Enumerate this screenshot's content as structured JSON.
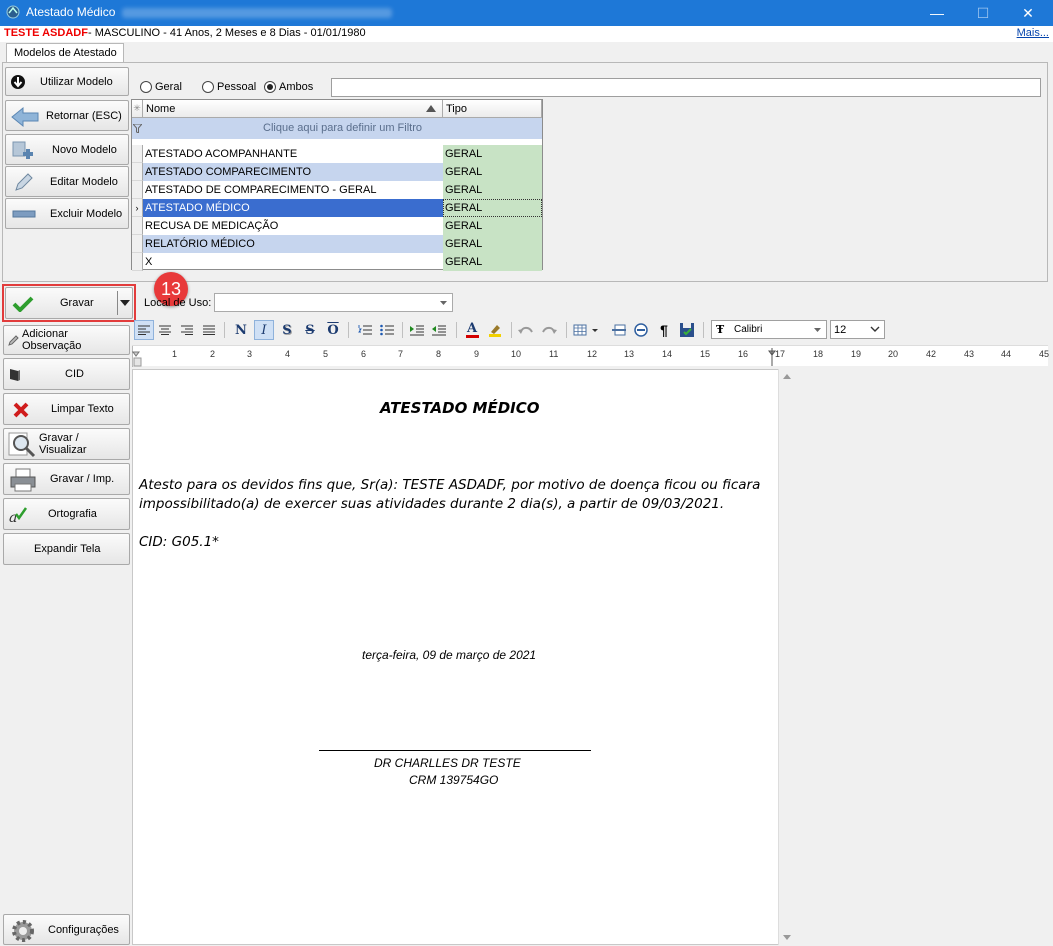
{
  "window": {
    "title": "Atestado Médico",
    "controls": {
      "minimize": "—",
      "maximize": "☐",
      "close": "✕"
    }
  },
  "patient": {
    "name": "TESTE ASDADF",
    "info": " - MASCULINO - 41 Anos, 2 Meses e 8 Dias - 01/01/1980",
    "more_link": "Mais..."
  },
  "tabs": [
    {
      "label": "Modelos de Atestado",
      "active": true
    }
  ],
  "model_actions": [
    {
      "label": "Utilizar Modelo",
      "icon": "arrow-down-circle-icon"
    },
    {
      "label": "Retornar (ESC)",
      "icon": "arrow-left-icon"
    },
    {
      "label": "Novo Modelo",
      "icon": "plus-icon"
    },
    {
      "label": "Editar Modelo",
      "icon": "pencil-icon"
    },
    {
      "label": "Excluir Modelo",
      "icon": "minus-icon"
    }
  ],
  "filters": {
    "options": [
      {
        "label": "Geral",
        "selected": false
      },
      {
        "label": "Pessoal",
        "selected": false
      },
      {
        "label": "Ambos",
        "selected": true
      }
    ],
    "search_value": ""
  },
  "grid": {
    "columns": [
      "Nome",
      "Tipo"
    ],
    "filter_row_text": "Clique aqui para definir um Filtro",
    "rows": [
      {
        "name": "ATESTADO ACOMPANHANTE",
        "type": "GERAL",
        "state": "normal"
      },
      {
        "name": "ATESTADO COMPARECIMENTO",
        "type": "GERAL",
        "state": "alt"
      },
      {
        "name": "ATESTADO DE COMPARECIMENTO - GERAL",
        "type": "GERAL",
        "state": "normal"
      },
      {
        "name": "ATESTADO MÉDICO",
        "type": "GERAL",
        "state": "selected"
      },
      {
        "name": "RECUSA DE MEDICAÇÃO",
        "type": "GERAL",
        "state": "normal"
      },
      {
        "name": "RELATÓRIO MÉDICO",
        "type": "GERAL",
        "state": "alt"
      },
      {
        "name": "X",
        "type": "GERAL",
        "state": "normal"
      }
    ]
  },
  "gravar": {
    "label": "Gravar",
    "badge": "13"
  },
  "local_uso": {
    "label": "Local de Uso:",
    "value": ""
  },
  "side_actions": [
    {
      "label": "Adicionar Observação",
      "icon": "pencil-small-icon"
    },
    {
      "label": "CID",
      "icon": "book-icon"
    },
    {
      "label": "Limpar Texto",
      "icon": "red-x-icon"
    },
    {
      "label": "Gravar / Visualizar",
      "icon": "magnifier-icon"
    },
    {
      "label": "Gravar / Imp.",
      "icon": "printer-icon"
    },
    {
      "label": "Ortografia",
      "icon": "spellcheck-icon"
    },
    {
      "label": "Expandir Tela",
      "icon": ""
    }
  ],
  "config": {
    "label": "Configurações"
  },
  "toolbar": {
    "bold": "N",
    "italic": "I",
    "shadow": "S",
    "strike": "S",
    "overline": "O",
    "pilcrow": "¶",
    "font": "Calibri",
    "size": "12"
  },
  "ruler": {
    "labels": [
      "1",
      "2",
      "3",
      "4",
      "5",
      "6",
      "7",
      "8",
      "9",
      "10",
      "11",
      "12",
      "13",
      "14",
      "15",
      "16",
      "17",
      "18",
      "19",
      "20",
      "42",
      "43",
      "44",
      "45"
    ]
  },
  "document": {
    "title": "ATESTADO MÉDICO",
    "body_line1": "Atesto para os devidos fins que, Sr(a): TESTE ASDADF, por motivo de doença ficou ou ficara",
    "body_line2": "impossibilitado(a) de exercer suas atividades durante 2 dia(s), a partir de 09/03/2021.",
    "cid_line": "CID: G05.1*",
    "date_line": "terça-feira, 09 de março de 2021",
    "doctor": "DR  CHARLLES DR TESTE",
    "crm": "CRM 139754GO"
  },
  "colors": {
    "titlebar": "#1e78d7",
    "grid_selected": "#3a6dcf",
    "grid_alt": "#c6d5ee",
    "tipo_bg": "#c8e3c5",
    "highlight": "#e23c3c"
  }
}
